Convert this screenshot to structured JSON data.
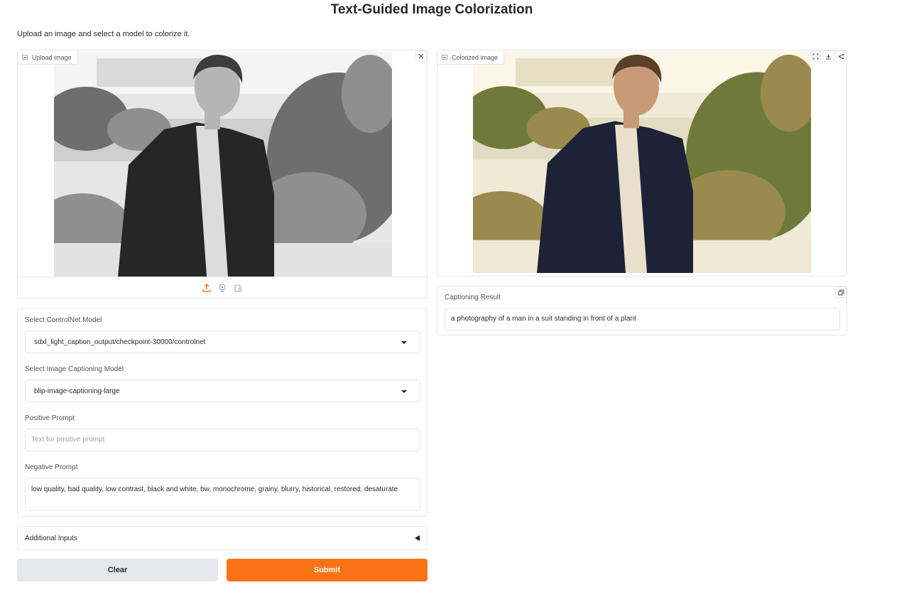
{
  "page": {
    "title": "Text-Guided Image Colorization",
    "subtitle": "Upload an image and select a model to colorize it."
  },
  "upload_panel": {
    "label": "Upload image",
    "label_icon": "image-icon",
    "close_icon": "close-icon",
    "toolbar_icons": [
      "upload-icon",
      "webcam-icon",
      "clipboard-icon"
    ],
    "accent_color": "#f97316"
  },
  "output_panel": {
    "label": "Colorized image",
    "label_icon": "image-icon",
    "action_icons": [
      "fullscreen-icon",
      "download-icon",
      "share-icon"
    ]
  },
  "caption": {
    "label": "Captioning Result",
    "value": "a photography of a man in a suit standing in front of a plant",
    "copy_icon": "copy-icon"
  },
  "controls": {
    "controlnet_label": "Select ControlNet Model",
    "controlnet_value": "sdxl_light_caption_output/checkpoint-30000/controlnet",
    "caption_model_label": "Select Image Captioning Model",
    "caption_model_value": "blip-image-captioning-large",
    "positive_label": "Positive Prompt",
    "positive_placeholder": "Text for positive prompt",
    "positive_value": "",
    "negative_label": "Negative Prompt",
    "negative_value": "low quality, bad quality, low contrast, black and white, bw, monochrome, grainy, blurry, historical, restored, desaturate"
  },
  "accordion": {
    "label": "Additional Inputs",
    "expanded": false
  },
  "buttons": {
    "clear": "Clear",
    "submit": "Submit"
  },
  "colors": {
    "submit_bg": "#f97316",
    "clear_bg": "#e5e7eb",
    "border": "#e5e7eb"
  }
}
